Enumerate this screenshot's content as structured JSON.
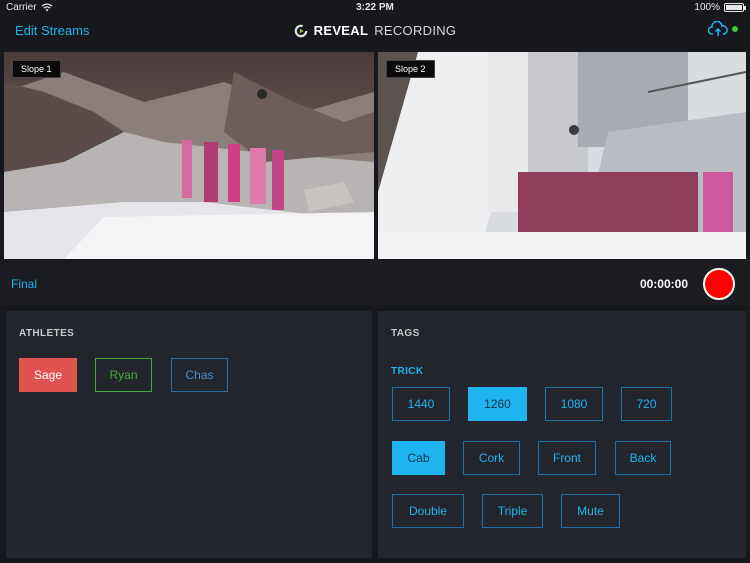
{
  "status": {
    "carrier": "Carrier",
    "time": "3:22 PM",
    "battery": "100%"
  },
  "nav": {
    "edit_streams": "Edit Streams",
    "brand_bold": "REVEAL",
    "brand_light": "RECORDING"
  },
  "streams": [
    {
      "label": "Slope 1"
    },
    {
      "label": "Slope 2"
    }
  ],
  "control": {
    "final": "Final",
    "timer": "00:00:00"
  },
  "athletes": {
    "title": "ATHLETES",
    "items": [
      {
        "label": "Sage",
        "color": "#e05250",
        "selected": true
      },
      {
        "label": "Ryan",
        "color": "#45a83a",
        "selected": false
      },
      {
        "label": "Chas",
        "color": "#2d6a9e",
        "selected": false
      }
    ]
  },
  "tags": {
    "title": "TAGS",
    "trick_title": "TRICK",
    "rows": [
      [
        {
          "label": "1440",
          "selected": false
        },
        {
          "label": "1260",
          "selected": true
        },
        {
          "label": "1080",
          "selected": false
        },
        {
          "label": "720",
          "selected": false
        }
      ],
      [
        {
          "label": "Cab",
          "selected": true
        },
        {
          "label": "Cork",
          "selected": false
        },
        {
          "label": "Front",
          "selected": false
        },
        {
          "label": "Back",
          "selected": false
        }
      ],
      [
        {
          "label": "Double",
          "selected": false
        },
        {
          "label": "Triple",
          "selected": false
        },
        {
          "label": "Mute",
          "selected": false
        }
      ]
    ]
  },
  "colors": {
    "accent": "#1fb3ef",
    "record": "#ff0000",
    "online": "#45c33c"
  },
  "icons": {
    "wifi": "wifi-icon",
    "battery": "battery-icon",
    "logo": "reveal-logo-icon",
    "upload": "cloud-upload-icon"
  }
}
